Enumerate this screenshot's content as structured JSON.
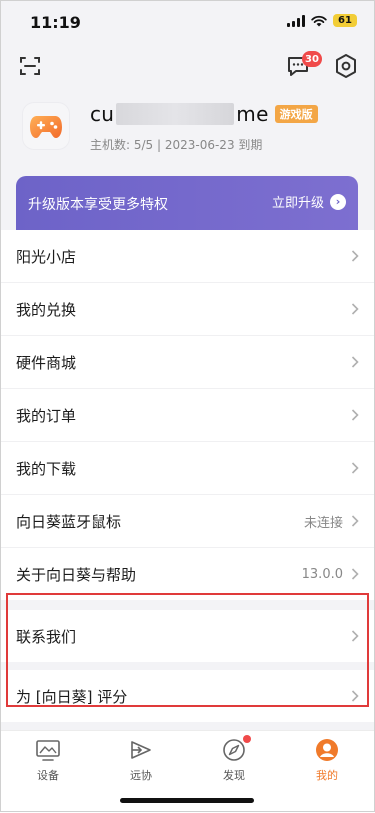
{
  "status_bar": {
    "time": "11:19",
    "battery": "61"
  },
  "top": {
    "message_badge": "30"
  },
  "profile": {
    "username_start": "cu",
    "username_end": "me",
    "edition_badge": "游戏版",
    "host_info": "主机数: 5/5 | 2023-06-23 到期"
  },
  "upgrade": {
    "text": "升级版本享受更多特权",
    "button": "立即升级"
  },
  "menu": [
    {
      "label": "阳光小店",
      "value": ""
    },
    {
      "label": "我的兑换",
      "value": ""
    },
    {
      "label": "硬件商城",
      "value": ""
    },
    {
      "label": "我的订单",
      "value": ""
    },
    {
      "label": "我的下载",
      "value": ""
    },
    {
      "label": "向日葵蓝牙鼠标",
      "value": "未连接"
    },
    {
      "label": "关于向日葵与帮助",
      "value": "13.0.0"
    },
    {
      "label": "联系我们",
      "value": ""
    },
    {
      "label": "为 [向日葵] 评分",
      "value": ""
    }
  ],
  "tabs": [
    {
      "label": "设备",
      "icon": "devices-icon",
      "active": false
    },
    {
      "label": "远协",
      "icon": "remote-assist-icon",
      "active": false
    },
    {
      "label": "发现",
      "icon": "compass-icon",
      "active": false
    },
    {
      "label": "我的",
      "icon": "profile-icon",
      "active": true
    }
  ],
  "colors": {
    "accent": "#f07a2a",
    "upgrade_bg": "#6d63c8",
    "badge": "#f04a4a",
    "highlight": "#e03a3a"
  }
}
